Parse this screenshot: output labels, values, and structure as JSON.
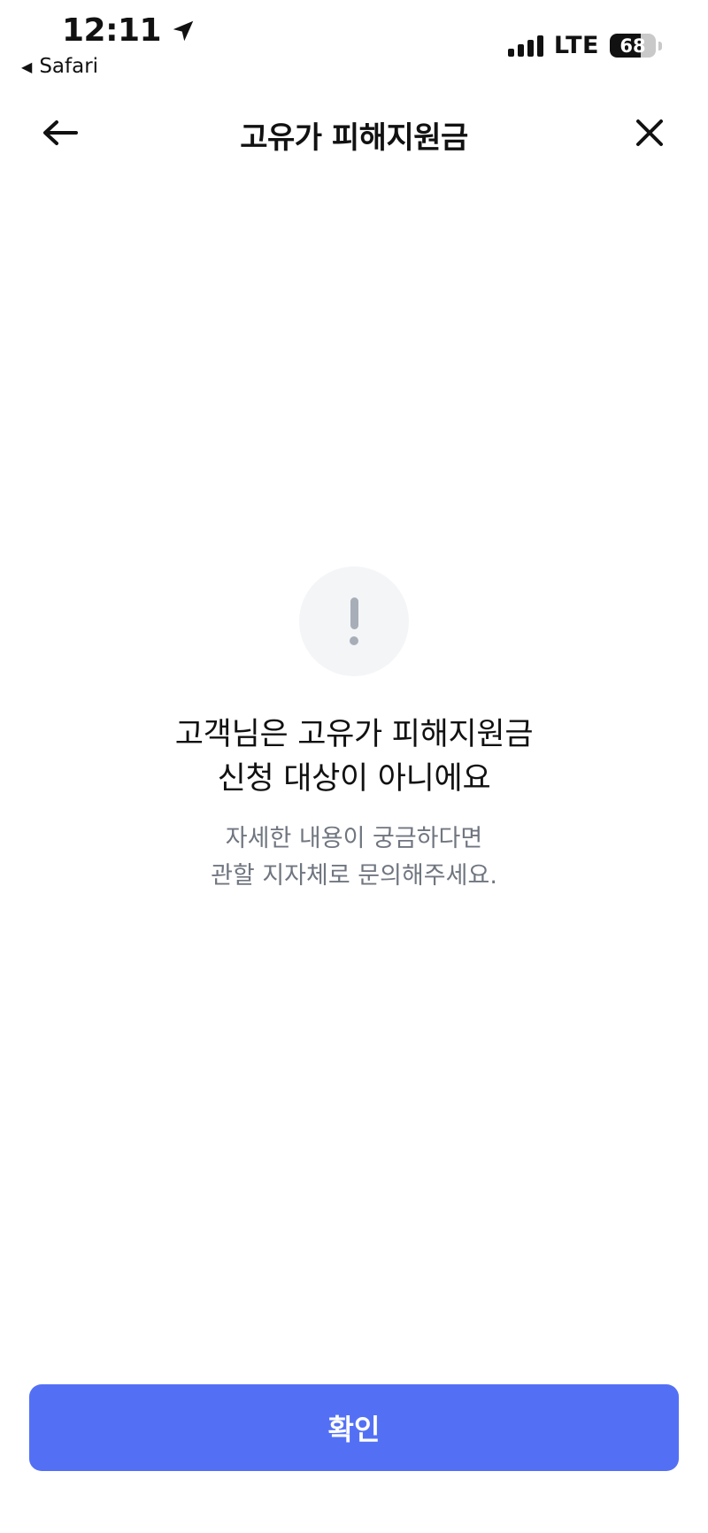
{
  "status_bar": {
    "time": "12:11",
    "back_app": "Safari",
    "network": "LTE",
    "battery": "68",
    "battery_level": 0.68
  },
  "nav": {
    "title": "고유가 피해지원금"
  },
  "message": {
    "line1": "고객님은 고유가 피해지원금",
    "line2": "신청 대상이 아니에요",
    "sub_line1": "자세한 내용이 궁금하다면",
    "sub_line2": "관할 지자체로 문의해주세요."
  },
  "confirm_label": "확인",
  "colors": {
    "accent": "#5370f5",
    "icon_gray": "#a8aeb8",
    "circle_bg": "#f4f5f7",
    "subtext": "#707680"
  },
  "icons": [
    "location-arrow-icon",
    "back-triangle-icon",
    "signal-icon",
    "battery-icon",
    "back-arrow-icon",
    "close-icon",
    "exclamation-icon"
  ]
}
